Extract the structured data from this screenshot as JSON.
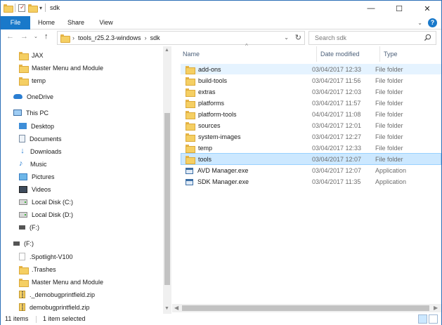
{
  "window": {
    "title": "sdk"
  },
  "titlebar": {
    "minimize": "—",
    "maximize": "☐",
    "close": "✕"
  },
  "ribbon": {
    "tabs": [
      {
        "label": "File",
        "active": true
      },
      {
        "label": "Home"
      },
      {
        "label": "Share"
      },
      {
        "label": "View"
      }
    ]
  },
  "address": {
    "breadcrumbs": [
      "tools_r25.2.3-windows",
      "sdk"
    ]
  },
  "search": {
    "placeholder": "Search sdk"
  },
  "navpane": {
    "items": [
      {
        "label": "JAX",
        "icon": "folder-icon"
      },
      {
        "label": "Master Menu and Module",
        "icon": "folder-icon"
      },
      {
        "label": "temp",
        "icon": "folder-icon"
      },
      {
        "label": "OneDrive",
        "icon": "onedrive-icon"
      },
      {
        "label": "This PC",
        "icon": "pc-icon"
      },
      {
        "label": "Desktop",
        "icon": "desktop-icon"
      },
      {
        "label": "Documents",
        "icon": "documents-icon"
      },
      {
        "label": "Downloads",
        "icon": "downloads-icon"
      },
      {
        "label": "Music",
        "icon": "music-icon"
      },
      {
        "label": "Pictures",
        "icon": "pictures-icon"
      },
      {
        "label": "Videos",
        "icon": "videos-icon"
      },
      {
        "label": "Local Disk (C:)",
        "icon": "disk-icon"
      },
      {
        "label": "Local Disk (D:)",
        "icon": "disk-icon"
      },
      {
        "label": "(F:)",
        "icon": "usb-drive-icon"
      },
      {
        "label": "(F:)",
        "icon": "usb-drive-icon"
      },
      {
        "label": ".Spotlight-V100",
        "icon": "file-icon"
      },
      {
        "label": ".Trashes",
        "icon": "folder-icon"
      },
      {
        "label": "Master Menu and Module",
        "icon": "folder-icon"
      },
      {
        "label": "._demobugprintfield.zip",
        "icon": "zip-icon"
      },
      {
        "label": "demobugprintfield.zip",
        "icon": "zip-icon"
      }
    ]
  },
  "columns": {
    "name": "Name",
    "date": "Date modified",
    "type": "Type"
  },
  "files": [
    {
      "name": "add-ons",
      "date": "03/04/2017 12:33",
      "type": "File folder",
      "icon": "folder-icon",
      "state": "hover"
    },
    {
      "name": "build-tools",
      "date": "03/04/2017 11:56",
      "type": "File folder",
      "icon": "folder-icon"
    },
    {
      "name": "extras",
      "date": "03/04/2017 12:03",
      "type": "File folder",
      "icon": "folder-icon"
    },
    {
      "name": "platforms",
      "date": "03/04/2017 11:57",
      "type": "File folder",
      "icon": "folder-icon"
    },
    {
      "name": "platform-tools",
      "date": "04/04/2017 11:08",
      "type": "File folder",
      "icon": "folder-icon"
    },
    {
      "name": "sources",
      "date": "03/04/2017 12:01",
      "type": "File folder",
      "icon": "folder-icon"
    },
    {
      "name": "system-images",
      "date": "03/04/2017 12:27",
      "type": "File folder",
      "icon": "folder-icon"
    },
    {
      "name": "temp",
      "date": "03/04/2017 12:33",
      "type": "File folder",
      "icon": "folder-icon"
    },
    {
      "name": "tools",
      "date": "03/04/2017 12:07",
      "type": "File folder",
      "icon": "folder-icon",
      "state": "selected"
    },
    {
      "name": "AVD Manager.exe",
      "date": "03/04/2017 12:07",
      "type": "Application",
      "icon": "application-icon"
    },
    {
      "name": "SDK Manager.exe",
      "date": "03/04/2017 11:35",
      "type": "Application",
      "icon": "application-icon"
    }
  ],
  "status": {
    "item_count": "11 items",
    "selection": "1 item selected"
  },
  "colors": {
    "accent": "#1979ca",
    "selection": "#cce8ff",
    "hover": "#e5f3ff"
  }
}
